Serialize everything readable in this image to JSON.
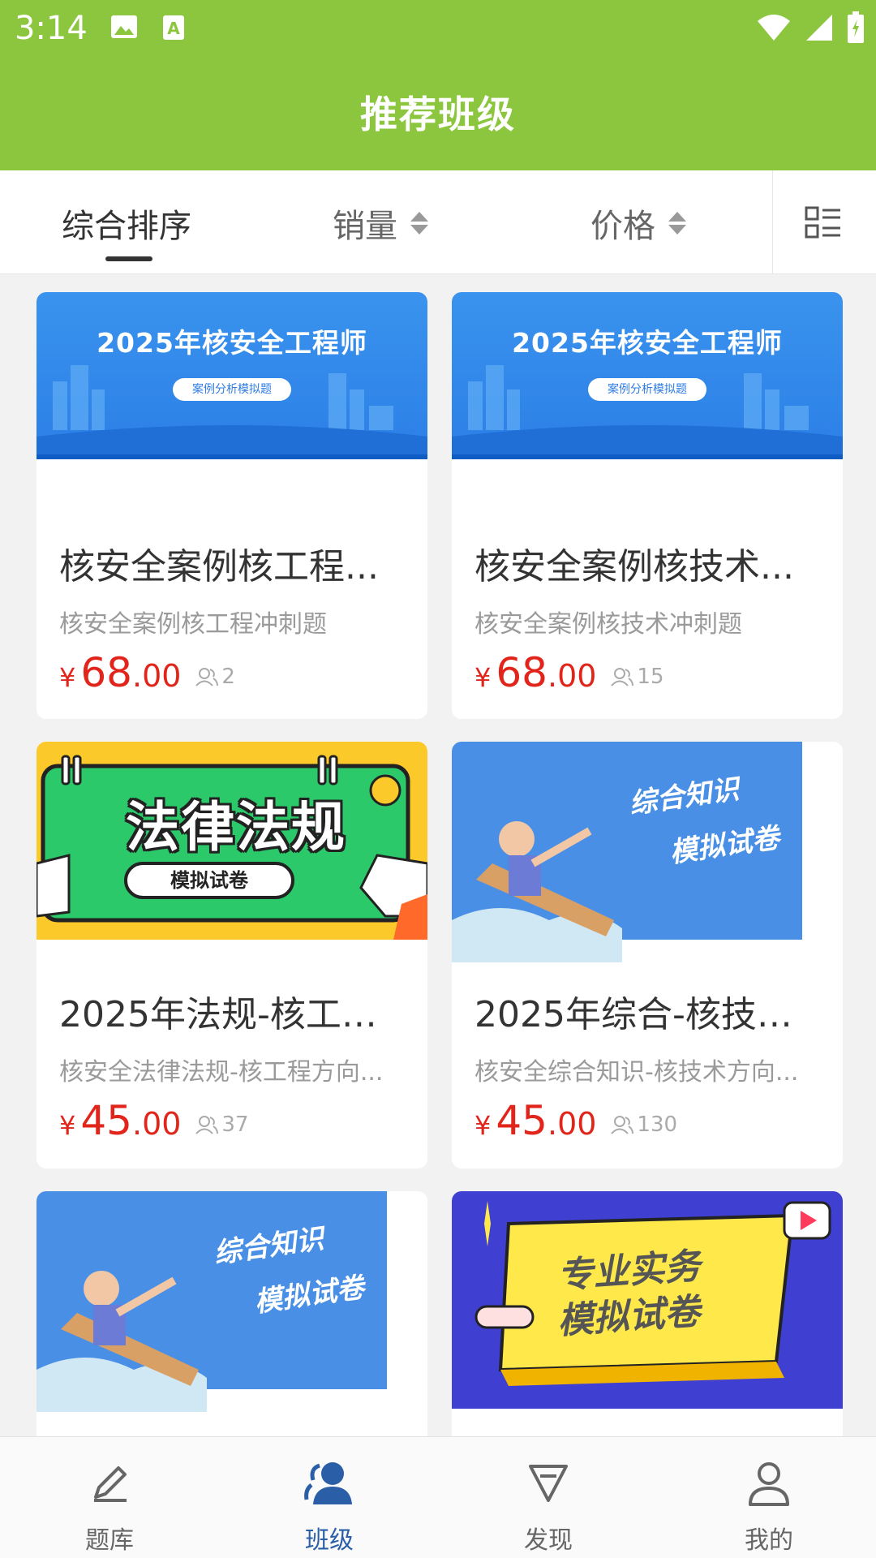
{
  "status_bar": {
    "time": "3:14",
    "icons": [
      "image-icon",
      "text-icon",
      "wifi-icon",
      "signal-icon",
      "battery-icon"
    ]
  },
  "header": {
    "title": "推荐班级"
  },
  "sort_bar": {
    "tabs": [
      {
        "label": "综合排序",
        "active": true
      },
      {
        "label": "销量",
        "sortable": true
      },
      {
        "label": "价格",
        "sortable": true
      }
    ],
    "layout_toggle_icon": "list-grid-icon"
  },
  "cards": [
    {
      "banner": {
        "title": "2025年核安全工程师",
        "pill": "案例分析模拟题"
      },
      "name": "核安全案例核工程...",
      "desc": "核安全案例核工程冲刺题",
      "currency": "¥",
      "price_int": "68",
      "price_dec": ".00",
      "buyers": "2"
    },
    {
      "banner": {
        "title": "2025年核安全工程师",
        "pill": "案例分析模拟题"
      },
      "name": "核安全案例核技术...",
      "desc": "核安全案例核技术冲刺题",
      "currency": "¥",
      "price_int": "68",
      "price_dec": ".00",
      "buyers": "15"
    },
    {
      "banner": {
        "title": "法律法规",
        "pill": "模拟试卷"
      },
      "name": "2025年法规-核工程...",
      "desc": "核安全法律法规-核工程方向...",
      "currency": "¥",
      "price_int": "45",
      "price_dec": ".00",
      "buyers": "37"
    },
    {
      "banner": {
        "line1": "综合知识",
        "line2": "模拟试卷"
      },
      "name": "2025年综合-核技术...",
      "desc": "核安全综合知识-核技术方向...",
      "currency": "¥",
      "price_int": "45",
      "price_dec": ".00",
      "buyers": "130"
    },
    {
      "banner": {
        "line1": "综合知识",
        "line2": "模拟试卷"
      }
    },
    {
      "banner": {
        "line1": "专业实务",
        "line2": "模拟试卷"
      }
    }
  ],
  "bottom_nav": [
    {
      "label": "题库",
      "icon": "pencil-icon"
    },
    {
      "label": "班级",
      "icon": "users-icon",
      "active": true
    },
    {
      "label": "发现",
      "icon": "discover-icon"
    },
    {
      "label": "我的",
      "icon": "profile-icon"
    }
  ],
  "colors": {
    "header_green": "#8cc63e",
    "price_red": "#e1251b",
    "nav_active": "#2a5fa8"
  }
}
